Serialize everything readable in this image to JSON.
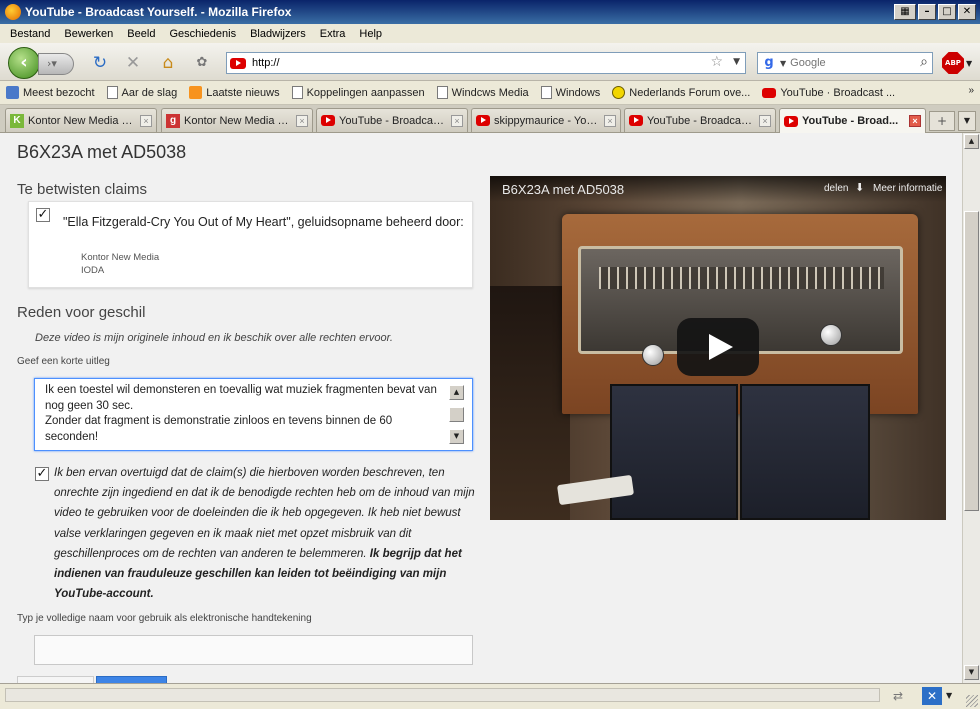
{
  "window": {
    "title": "YouTube - Broadcast Yourself. - Mozilla Firefox",
    "buttons": [
      "▦",
      "–",
      "□",
      "✕"
    ]
  },
  "menu": [
    "Bestand",
    "Bewerken",
    "Beeld",
    "Geschiedenis",
    "Bladwijzers",
    "Extra",
    "Help"
  ],
  "navbar": {
    "url": "http://",
    "search_placeholder": "Google",
    "abp_label": "ABP"
  },
  "bookmarks": [
    {
      "label": "Meest bezocht",
      "icon": "star-page-icon"
    },
    {
      "label": "Aar de slag",
      "icon": "page-icon"
    },
    {
      "label": "Laatste nieuws",
      "icon": "rss-icon"
    },
    {
      "label": "Koppelingen aanpassen",
      "icon": "page-icon"
    },
    {
      "label": "Windcws Media",
      "icon": "page-icon"
    },
    {
      "label": "Windows",
      "icon": "page-icon"
    },
    {
      "label": "Nederlands Forum ove...",
      "icon": "smiley-icon"
    },
    {
      "label": "YouTube · Broadcast ...",
      "icon": "youtube-icon"
    }
  ],
  "bookmarks_more": "»",
  "tabs": [
    {
      "label": "Kontor New Media G...",
      "icon": "k"
    },
    {
      "label": "Kontor New Media G...",
      "icon": "g"
    },
    {
      "label": "YouTube - Broadcast...",
      "icon": "yt"
    },
    {
      "label": "skippymaurice - YouT...",
      "icon": "yt"
    },
    {
      "label": "YouTube - Broadcast...",
      "icon": "yt"
    },
    {
      "label": "YouTube - Broad...",
      "icon": "yt"
    }
  ],
  "page": {
    "title": "B6X23A met AD5038",
    "claims_heading": "Te betwisten claims",
    "claim_text": "\"Ella Fitzgerald-Cry You Out of My Heart\", geluidsopname beheerd door:",
    "claim_owner_1": "Kontor New Media",
    "claim_owner_2": "IODA",
    "reason_heading": "Reden voor geschil",
    "reason_note": "Deze video is mijn originele inhoud en ik beschik over alle rechten ervoor.",
    "explain_label": "Geef een korte uitleg",
    "explain_value": "Ik een toestel wil demonsteren en toevallig wat muziek fragmenten bevat van nog geen 30 sec.\nZonder dat fragment is demonstratie zinloos en tevens binnen de 60 seconden!",
    "agree_text": "Ik ben ervan overtuigd dat de claim(s) die hierboven worden beschreven, ten onrechte zijn ingediend en dat ik de benodigde rechten heb om de inhoud van mijn video te gebruiken voor de doeleinden die ik heb opgegeven. Ik heb niet bewust valse verklaringen gegeven en ik maak niet met opzet misbruik van dit geschillenproces om de rechten van anderen te belemmeren. ",
    "agree_bold": "Ik begrijp dat het indienen van frauduleuze geschillen kan leiden tot beëindiging van mijn YouTube-account.",
    "signature_label": "Typ je volledige naam voor gebruik als elektronische handtekening",
    "signature_value": ""
  },
  "video": {
    "title": "B6X23A met AD5038",
    "share_label": "delen",
    "more_label": "Meer informatie"
  }
}
